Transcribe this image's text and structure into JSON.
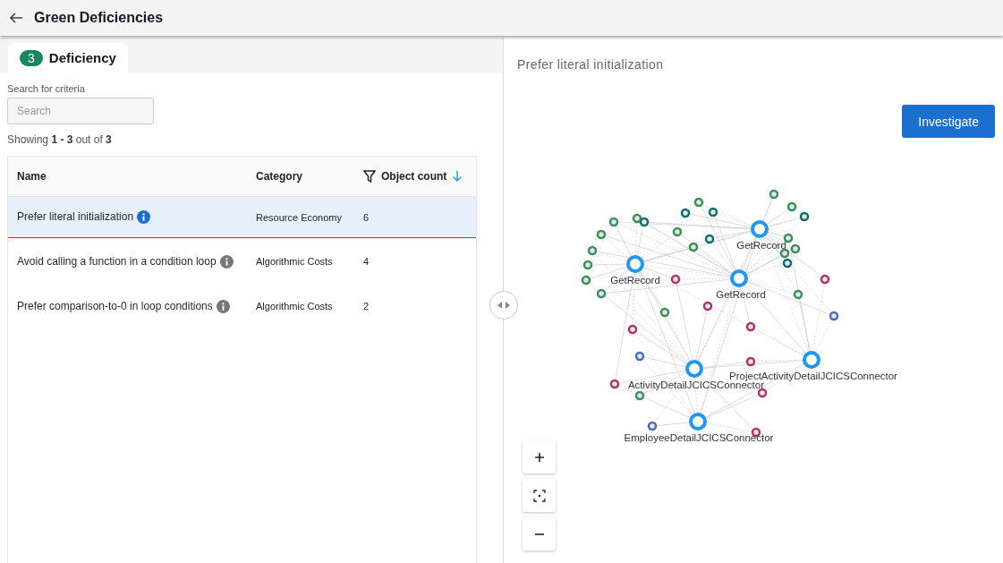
{
  "header": {
    "title": "Green Deficiencies"
  },
  "tabs": [
    {
      "label": "Deficiency",
      "count": "3",
      "selected": true
    }
  ],
  "search": {
    "label": "Search for criteria",
    "placeholder": "Search"
  },
  "showing": "Showing **1 - 3** out of **3**",
  "table": {
    "columns": [
      {
        "label": "Name",
        "filterable": false,
        "sorted": false
      },
      {
        "label": "Category",
        "filterable": false,
        "sorted": false
      },
      {
        "label": "Object count",
        "filterable": true,
        "sorted": true
      }
    ],
    "rows": [
      {
        "name": "Prefer literal initialization",
        "category": "Resource Economy",
        "count": "6",
        "selected": true
      },
      {
        "name": "Avoid calling a function in a condition loop",
        "category": "Algorithmic Costs",
        "count": "4",
        "selected": false
      },
      {
        "name": "Prefer comparison-to-0 in loop conditions",
        "category": "Algorithmic Costs",
        "count": "2",
        "selected": false
      }
    ]
  },
  "detail": {
    "title": "Prefer literal initialization",
    "button": "Investigate",
    "graph_labels": [
      "GetRecord",
      "GetRecord",
      "GetRecord",
      "ActivityDetailJCICSConnector",
      "ProjectActivityDetailJCICSConnector",
      "EmployeeDetailJCICSConnector"
    ]
  }
}
